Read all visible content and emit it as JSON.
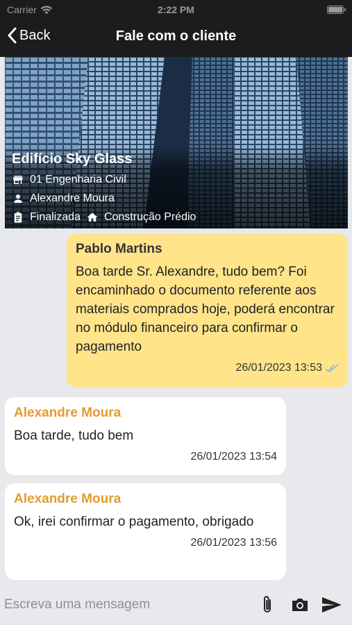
{
  "status": {
    "carrier": "Carrier",
    "time": "2:22 PM",
    "battery": 1.0
  },
  "nav": {
    "back_label": "Back",
    "title": "Fale com o cliente"
  },
  "project": {
    "name": "Edifício Sky Glass",
    "company": "01 Engenharia Civil",
    "client": "Alexandre Moura",
    "status": "Finalizada",
    "category": "Construção Prédio"
  },
  "messages": [
    {
      "direction": "outgoing",
      "sender": "Pablo Martins",
      "text": "Boa tarde Sr. Alexandre, tudo bem? Foi encaminhado o documento referente aos materiais comprados hoje, poderá encontrar no módulo financeiro para confirmar o pagamento",
      "timestamp": "26/01/2023 13:53",
      "read_icon": "double-check-icon"
    },
    {
      "direction": "incoming",
      "sender": "Alexandre Moura",
      "text": "Boa tarde, tudo bem",
      "timestamp": "26/01/2023 13:54"
    },
    {
      "direction": "incoming",
      "sender": "Alexandre Moura",
      "text": "Ok, irei confirmar o pagamento, obrigado",
      "timestamp": "26/01/2023 13:56"
    }
  ],
  "composer": {
    "placeholder": "Escreva uma mensagem",
    "value": ""
  },
  "colors": {
    "incoming_sender": "#e39b2e",
    "outgoing_bubble": "#ffe48a",
    "read_check": "#7fb8e8"
  }
}
